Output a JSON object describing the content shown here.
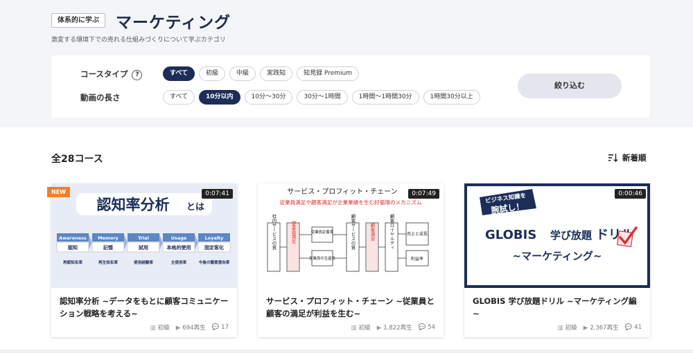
{
  "header": {
    "tag": "体系的に学ぶ",
    "title": "マーケティング",
    "description": "激変する環境下での売れる仕組みづくりについて学ぶカテゴリ"
  },
  "filters": {
    "course_type_label": "コースタイプ",
    "help": "?",
    "course_types": [
      "すべて",
      "初級",
      "中級",
      "実践知",
      "知見録 Premium"
    ],
    "course_type_selected": "すべて",
    "length_label": "動画の長さ",
    "lengths": [
      "すべて",
      "10分以内",
      "10分〜30分",
      "30分〜1時間",
      "1時間〜1時間30分",
      "1時間30分以上"
    ],
    "length_selected": "10分以内",
    "apply_label": "絞り込む"
  },
  "results": {
    "total": "全28コース",
    "sort_label": "新着順"
  },
  "cards": [
    {
      "badge": "NEW",
      "duration": "0:07:41",
      "title": "認知率分析 ~データをもとに顧客コミュニケーション戦略を考える~",
      "level": "初級",
      "plays": "694再生",
      "comments": "17",
      "thumb_title": "認知率分析",
      "thumb_title_suffix": "とは",
      "funnel": [
        {
          "head": "Awareness",
          "body": "認知",
          "foot": "再認知名率"
        },
        {
          "head": "Memory",
          "body": "記憶",
          "foot": "再生知名率"
        },
        {
          "head": "Trial",
          "body": "試用",
          "foot": "使用経験率"
        },
        {
          "head": "Usage",
          "body": "本格的使用",
          "foot": "主使用率"
        },
        {
          "head": "Loyalty",
          "body": "固定客化",
          "foot": "今後の購買意向率"
        }
      ]
    },
    {
      "badge": "",
      "duration": "0:07:49",
      "title": "サービス・プロフィット・チェーン ~従業員と顧客の満足が利益を生む~",
      "level": "初級",
      "plays": "1,822再生",
      "comments": "54",
      "thumb_title": "サービス・プロフィット・チェーン",
      "thumb_subtitle": "従業員満足や顧客満足が企業業績を生む好循環のメカニズム",
      "diagram": {
        "c1": "社内サービスの質",
        "c2": "従業員満足",
        "c3a": "従業員定着率",
        "c3b": "従業員の生産性",
        "c4": "顧客サービスの質",
        "c5": "顧客満足",
        "c6": "顧客ロイヤルティ",
        "c7a": "売上と成長",
        "c7b": "利益率"
      }
    },
    {
      "badge": "",
      "duration": "0:00:46",
      "title": "GLOBIS 学び放題ドリル ~マーケティング編~",
      "level": "初級",
      "plays": "2,367再生",
      "comments": "41",
      "thumb_bubble_line1": "ビジネス知識を",
      "thumb_bubble_line2": "腕試し！",
      "thumb_brand": "GLOBIS",
      "thumb_brand_jp1": "学び放題",
      "thumb_brand_jp2": "ドリル",
      "thumb_sub": "~マーケティング~"
    }
  ],
  "colors": {
    "navy": "#1b2d58",
    "orange": "#f0812a",
    "funnel_blue": "#5b87c4",
    "red": "#d8322f"
  }
}
